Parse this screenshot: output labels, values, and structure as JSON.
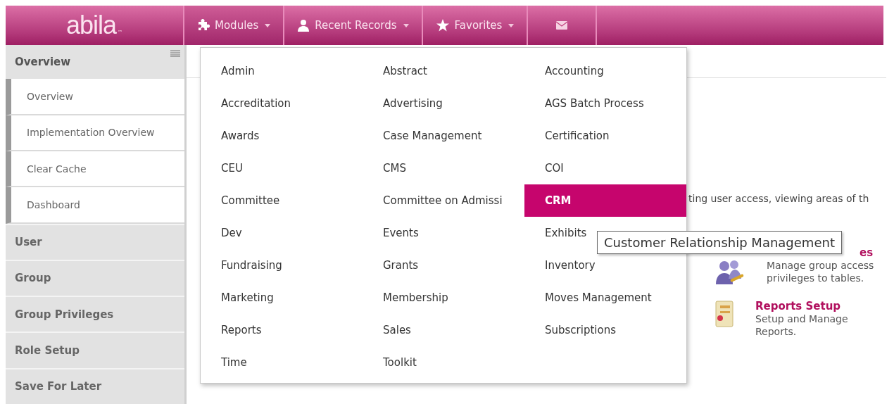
{
  "logo": {
    "text": "abila",
    "mark": "™"
  },
  "nav": [
    {
      "kind": "modules",
      "label": "Modules",
      "selected": true
    },
    {
      "kind": "recent",
      "label": "Recent Records",
      "selected": false
    },
    {
      "kind": "favorites",
      "label": "Favorites",
      "selected": false
    },
    {
      "kind": "mail",
      "selected": false
    }
  ],
  "sidebar": {
    "header": "Overview",
    "sub_items": [
      "Overview",
      "Implementation Overview",
      "Clear Cache",
      "Dashboard"
    ],
    "sections": [
      "User",
      "Group",
      "Group Privileges",
      "Role Setup",
      "Save For Later"
    ]
  },
  "main": {
    "description": "ting user access, viewing areas of th",
    "cards": [
      {
        "kind": "group",
        "title": "es",
        "text": "Manage group access privileges to tables."
      },
      {
        "kind": "reports",
        "title": "Reports Setup",
        "text": "Setup and Manage Reports."
      }
    ]
  },
  "modules_menu": {
    "items": [
      {
        "label": "Admin",
        "selected": false
      },
      {
        "label": "Abstract",
        "selected": false
      },
      {
        "label": "Accounting",
        "selected": false
      },
      {
        "label": "Accreditation",
        "selected": false
      },
      {
        "label": "Advertising",
        "selected": false
      },
      {
        "label": "AGS Batch Process",
        "selected": false
      },
      {
        "label": "Awards",
        "selected": false
      },
      {
        "label": "Case Management",
        "selected": false
      },
      {
        "label": "Certification",
        "selected": false
      },
      {
        "label": "CEU",
        "selected": false
      },
      {
        "label": "CMS",
        "selected": false
      },
      {
        "label": "COI",
        "selected": false
      },
      {
        "label": "Committee",
        "selected": false
      },
      {
        "label": "Committee on Admissi",
        "selected": false
      },
      {
        "label": "CRM",
        "selected": true
      },
      {
        "label": "Dev",
        "selected": false
      },
      {
        "label": "Events",
        "selected": false
      },
      {
        "label": "Exhibits",
        "selected": false
      },
      {
        "label": "Fundraising",
        "selected": false
      },
      {
        "label": "Grants",
        "selected": false
      },
      {
        "label": "Inventory",
        "selected": false
      },
      {
        "label": "Marketing",
        "selected": false
      },
      {
        "label": "Membership",
        "selected": false
      },
      {
        "label": "Moves Management",
        "selected": false
      },
      {
        "label": "Reports",
        "selected": false
      },
      {
        "label": "Sales",
        "selected": false
      },
      {
        "label": "Subscriptions",
        "selected": false
      },
      {
        "label": "Time",
        "selected": false
      },
      {
        "label": "Toolkit",
        "selected": false
      }
    ],
    "tooltip": "Customer Relationship Management"
  }
}
